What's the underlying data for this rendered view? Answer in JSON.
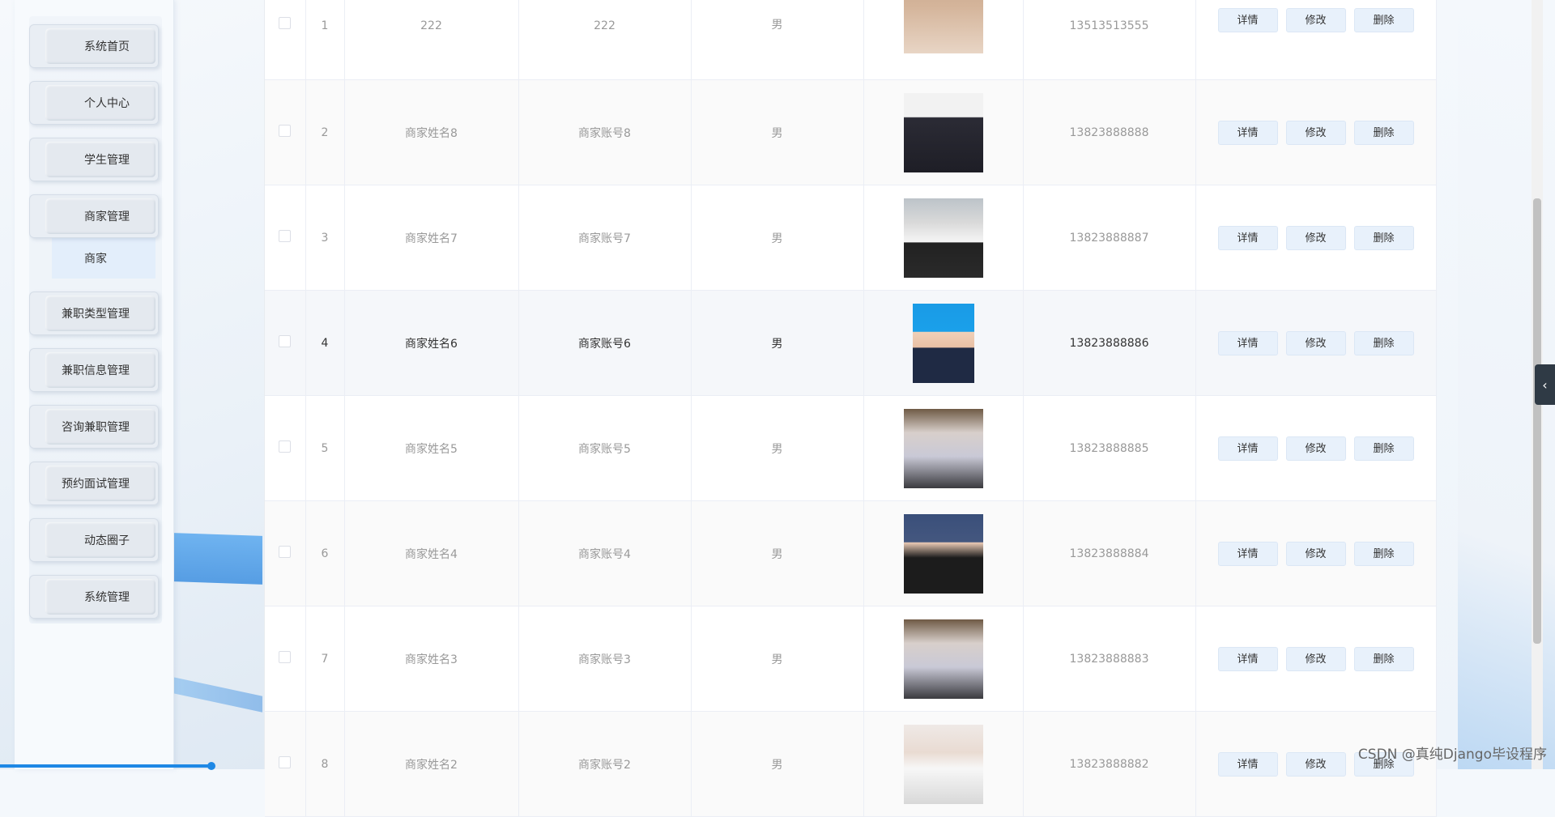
{
  "sidebar": {
    "items": [
      {
        "label": "系统首页"
      },
      {
        "label": "个人中心"
      },
      {
        "label": "学生管理"
      },
      {
        "label": "商家管理"
      },
      {
        "label": "兼职类型管理"
      },
      {
        "label": "兼职信息管理"
      },
      {
        "label": "咨询兼职管理"
      },
      {
        "label": "预约面试管理"
      },
      {
        "label": "动态圈子"
      },
      {
        "label": "系统管理"
      }
    ],
    "submenu_label": "商家"
  },
  "table": {
    "actions": {
      "detail": "详情",
      "edit": "修改",
      "delete": "删除"
    },
    "rows": [
      {
        "index": "1",
        "name": "222",
        "account": "222",
        "gender": "男",
        "phone": "13513513555"
      },
      {
        "index": "2",
        "name": "商家姓名8",
        "account": "商家账号8",
        "gender": "男",
        "phone": "13823888888"
      },
      {
        "index": "3",
        "name": "商家姓名7",
        "account": "商家账号7",
        "gender": "男",
        "phone": "13823888887"
      },
      {
        "index": "4",
        "name": "商家姓名6",
        "account": "商家账号6",
        "gender": "男",
        "phone": "13823888886"
      },
      {
        "index": "5",
        "name": "商家姓名5",
        "account": "商家账号5",
        "gender": "男",
        "phone": "13823888885"
      },
      {
        "index": "6",
        "name": "商家姓名4",
        "account": "商家账号4",
        "gender": "男",
        "phone": "13823888884"
      },
      {
        "index": "7",
        "name": "商家姓名3",
        "account": "商家账号3",
        "gender": "男",
        "phone": "13823888883"
      },
      {
        "index": "8",
        "name": "商家姓名2",
        "account": "商家账号2",
        "gender": "男",
        "phone": "13823888882"
      }
    ]
  },
  "watermark": "CSDN @真纯Django毕设程序",
  "icons": {
    "collapse": "chevron-left-icon"
  }
}
